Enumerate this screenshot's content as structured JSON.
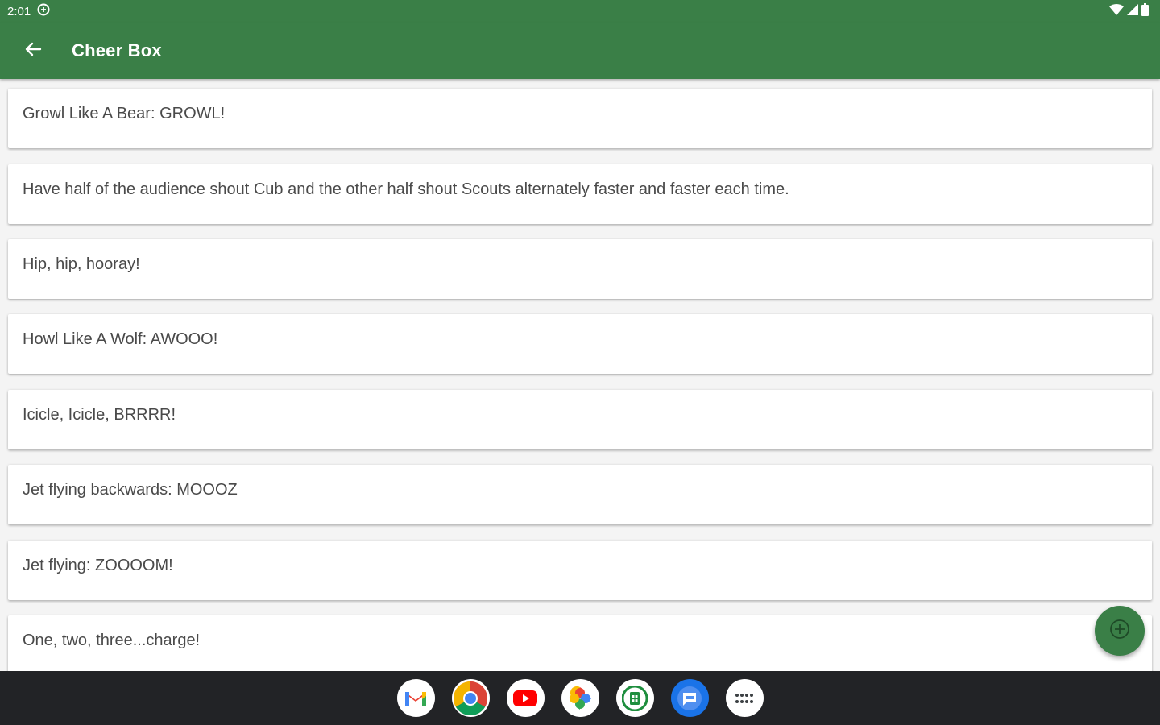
{
  "status_bar": {
    "time": "2:01",
    "icons": [
      "data-saver-icon",
      "wifi-icon",
      "signal-icon",
      "battery-icon"
    ]
  },
  "app_bar": {
    "title": "Cheer Box",
    "back_icon": "arrow-back-icon",
    "background": "#3a7f47"
  },
  "cheers": [
    {
      "text": "Growl Like A Bear: GROWL!"
    },
    {
      "text": "Have half of the audience shout Cub and the other half shout Scouts alternately faster and faster each time."
    },
    {
      "text": "Hip, hip, hooray!"
    },
    {
      "text": "Howl Like A Wolf: AWOOO!"
    },
    {
      "text": "Icicle, Icicle, BRRRR!"
    },
    {
      "text": "Jet flying backwards: MOOOZ"
    },
    {
      "text": "Jet flying: ZOOOOM!"
    },
    {
      "text": "One, two, three...charge!"
    }
  ],
  "fab": {
    "icon": "add-circle-icon",
    "color": "#3a7f47"
  },
  "dock": {
    "apps": [
      "gmail-icon",
      "chrome-icon",
      "youtube-icon",
      "photos-icon",
      "sheets-icon",
      "messages-icon",
      "app-drawer-icon"
    ]
  }
}
